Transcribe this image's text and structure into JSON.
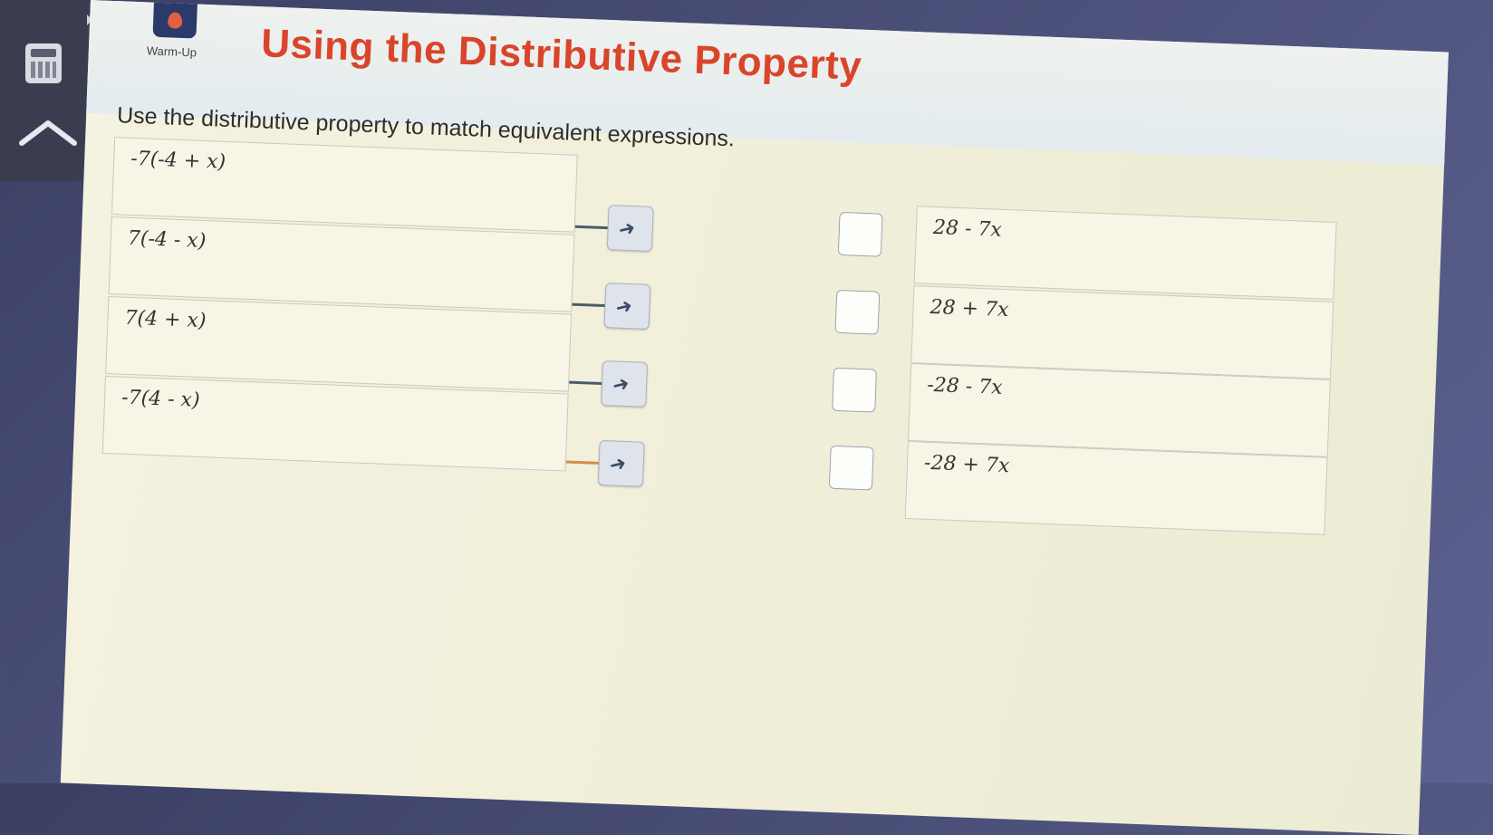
{
  "header": {
    "logo_caption": "Warm-Up",
    "title": "Using the Distributive Property"
  },
  "instructions": "Use the distributive property to match equivalent expressions.",
  "left_items": [
    {
      "expr": "-7(-4 + x)"
    },
    {
      "expr": "7(-4 - x)"
    },
    {
      "expr": "7(4 + x)"
    },
    {
      "expr": "-7(4 - x)"
    }
  ],
  "right_items": [
    {
      "expr": "28 - 7x"
    },
    {
      "expr": "28 + 7x"
    },
    {
      "expr": "-28 - 7x"
    },
    {
      "expr": "-28 + 7x"
    }
  ],
  "icons": {
    "calculator": "calculator-icon",
    "collapse": "chevron-up-icon",
    "drag": "drag-arrow-icon"
  },
  "colors": {
    "title": "#d9452b",
    "connector": "#4a5b6a",
    "connector_active": "#d98b4a"
  }
}
